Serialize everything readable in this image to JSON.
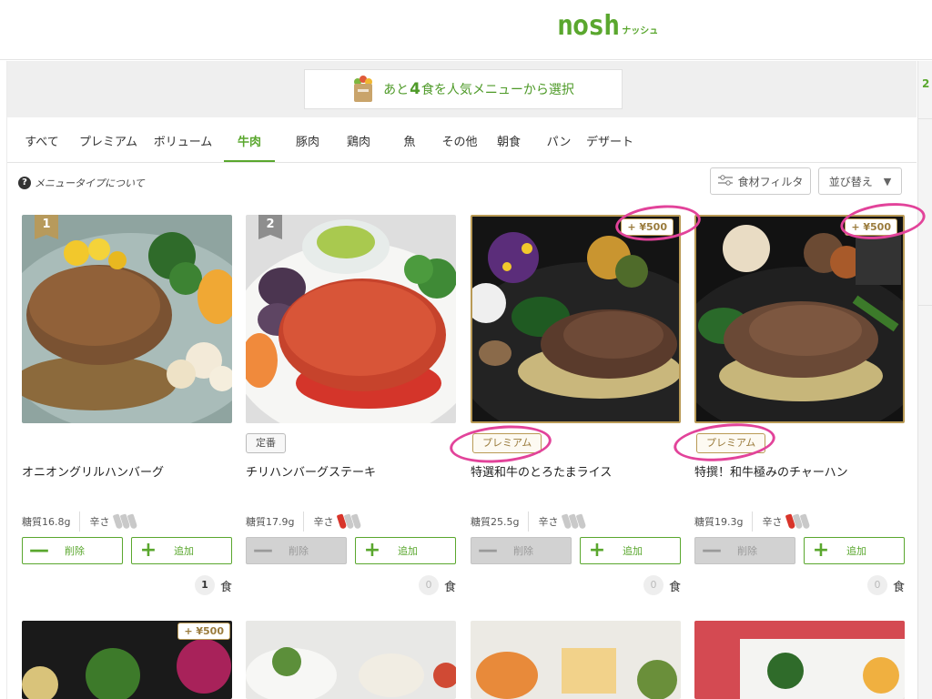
{
  "header": {
    "logo_main": "nosh",
    "logo_kana": "ナッシュ"
  },
  "banner": {
    "prefix": "あと",
    "remaining": "4",
    "suffix": "食を人気メニューから選択"
  },
  "side": {
    "number": "2"
  },
  "tabs": [
    {
      "label": "すべて",
      "active": false
    },
    {
      "label": "プレミアム",
      "active": false
    },
    {
      "label": "ボリューム",
      "active": false
    },
    {
      "label": "牛肉",
      "active": true
    },
    {
      "label": "豚肉",
      "active": false
    },
    {
      "label": "鶏肉",
      "active": false
    },
    {
      "label": "魚",
      "active": false
    },
    {
      "label": "その他",
      "active": false
    },
    {
      "label": "朝食",
      "active": false
    },
    {
      "label": "パン",
      "active": false
    },
    {
      "label": "デザート",
      "active": false
    }
  ],
  "toolbar": {
    "about_icon": "?",
    "about_label": "メニュータイプについて",
    "filter_label": "食材フィルタ",
    "sort_label": "並び替え",
    "sort_caret": "▼"
  },
  "labels": {
    "delete": "削除",
    "add": "追加",
    "unit": "食",
    "spicy": "辛さ",
    "minus": "—",
    "plus": "+"
  },
  "cards": [
    {
      "rank": "1",
      "name": "オニオングリルハンバーグ",
      "carbs": "糖質16.8g",
      "spice_level": 0,
      "count": "1",
      "tag": "",
      "price": ""
    },
    {
      "rank": "2",
      "name": "チリハンバーグステーキ",
      "carbs": "糖質17.9g",
      "spice_level": 1,
      "count": "0",
      "tag": "定番",
      "price": ""
    },
    {
      "rank": "",
      "name": "特選和牛のとろたまライス",
      "carbs": "糖質25.5g",
      "spice_level": 0,
      "count": "0",
      "tag": "プレミアム",
      "price": "+ ¥500"
    },
    {
      "rank": "",
      "name": "特撰！和牛極みのチャーハン",
      "carbs": "糖質19.3g",
      "spice_level": 1,
      "count": "0",
      "tag": "プレミアム",
      "price": "+ ¥500"
    }
  ],
  "bottom_cards": [
    {
      "price": "+ ¥500"
    }
  ],
  "colors": {
    "brand_green": "#5aa72e",
    "gold": "#b99a55",
    "annotation_pink": "#e2439a",
    "pepper_red": "#d8342a"
  }
}
